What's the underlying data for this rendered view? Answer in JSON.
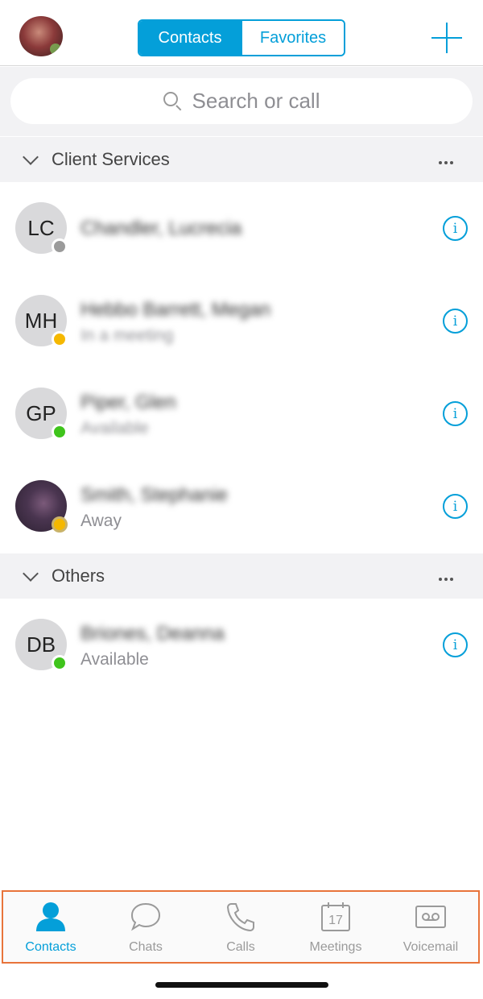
{
  "header": {
    "segments": [
      "Contacts",
      "Favorites"
    ],
    "active_segment": "Contacts",
    "add_icon": "plus-icon"
  },
  "search": {
    "placeholder": "Search or call"
  },
  "groups": [
    {
      "title": "Client Services",
      "contacts": [
        {
          "initials": "LC",
          "name": "Chandler, Lucrecia",
          "status": "",
          "presence": "offline"
        },
        {
          "initials": "MH",
          "name": "Hebbo Barrett, Megan",
          "status": "In a meeting",
          "presence": "busy"
        },
        {
          "initials": "GP",
          "name": "Piper, Glen",
          "status": "Available",
          "presence": "available"
        },
        {
          "initials": "",
          "name": "Smith, Stephanie",
          "status": "Away",
          "presence": "away"
        }
      ]
    },
    {
      "title": "Others",
      "contacts": [
        {
          "initials": "DB",
          "name": "Briones, Deanna",
          "status": "Available",
          "presence": "available"
        }
      ]
    }
  ],
  "tabbar": {
    "tabs": [
      {
        "label": "Contacts",
        "icon": "person-icon",
        "active": true
      },
      {
        "label": "Chats",
        "icon": "chat-bubble-icon",
        "active": false
      },
      {
        "label": "Calls",
        "icon": "phone-icon",
        "active": false
      },
      {
        "label": "Meetings",
        "icon": "calendar-icon",
        "active": false,
        "badge": "17"
      },
      {
        "label": "Voicemail",
        "icon": "voicemail-icon",
        "active": false
      }
    ]
  },
  "colors": {
    "accent": "#049fd9",
    "presence_available": "#3fc41c",
    "presence_busy": "#f5b800",
    "presence_offline": "#9b9b9b",
    "highlight_border": "#e8743b"
  }
}
